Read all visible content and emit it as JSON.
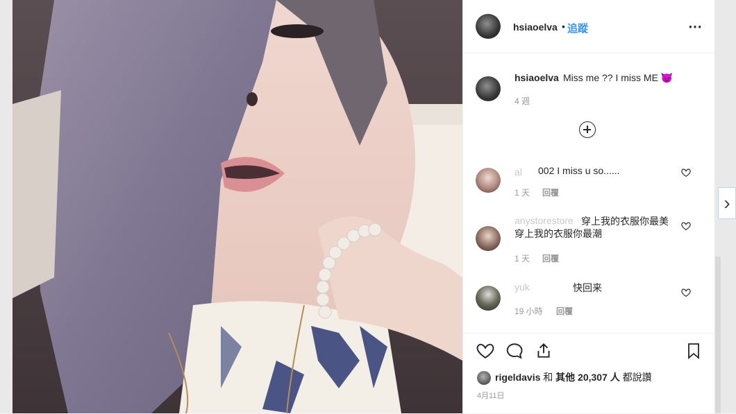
{
  "post": {
    "username": "hsiaoelva",
    "separator": "•",
    "follow_label": "追蹤",
    "more_icon": "⋯"
  },
  "caption": {
    "username": "hsiaoelva",
    "text": "Miss me ?? I miss ME 😈",
    "time": "4 週"
  },
  "comments": [
    {
      "user": "al",
      "text": "002 I miss u so......",
      "time": "1 天",
      "reply": "回覆"
    },
    {
      "user": "anystorestore",
      "text": "穿上我的衣服你最美 穿上我的衣服你最潮",
      "time": "1 天",
      "reply": "回覆"
    },
    {
      "user": "yuk",
      "text": "快回来",
      "time": "19 小時",
      "reply": "回覆"
    }
  ],
  "likes": {
    "user": "rigeldavis",
    "and": "和",
    "others": "其他 20,307 人",
    "suffix": "都說讚"
  },
  "date": "4月11日",
  "nav": {
    "next_icon": "›"
  },
  "colors": {
    "accent": "#3897f0",
    "text": "#262626",
    "muted": "#999999"
  }
}
